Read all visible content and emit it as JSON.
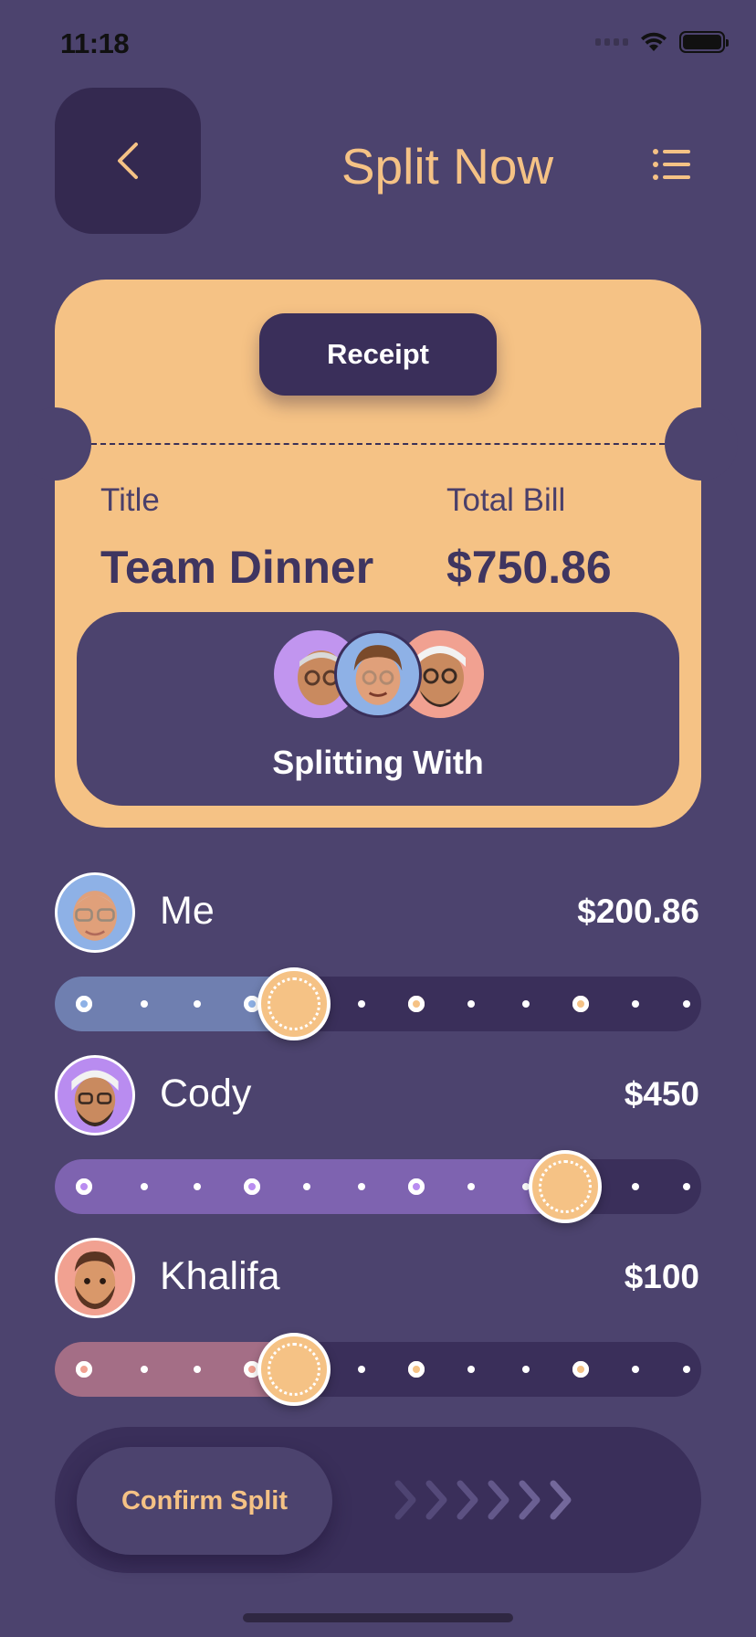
{
  "status_bar": {
    "time": "11:18"
  },
  "header": {
    "title": "Split Now"
  },
  "receipt": {
    "tab_label": "Receipt",
    "title_label": "Title",
    "title_value": "Team Dinner",
    "total_label": "Total Bill",
    "total_value": "$750.86",
    "splitting_label": "Splitting With"
  },
  "participants": [
    {
      "name": "Me",
      "amount": "$200.86",
      "share_fraction": 0.37,
      "color": "#6f7fb0",
      "avatar_bg": "#8eb1e6"
    },
    {
      "name": "Cody",
      "amount": "$450",
      "share_fraction": 0.79,
      "color": "#7e63b0",
      "avatar_bg": "#b98cf0"
    },
    {
      "name": "Khalifa",
      "amount": "$100",
      "share_fraction": 0.37,
      "color": "#a46e86",
      "avatar_bg": "#f1a191"
    }
  ],
  "confirm": {
    "label": "Confirm Split"
  },
  "colors": {
    "background": "#4c436e",
    "accent": "#f5c285",
    "dark": "#3a2f5a"
  }
}
